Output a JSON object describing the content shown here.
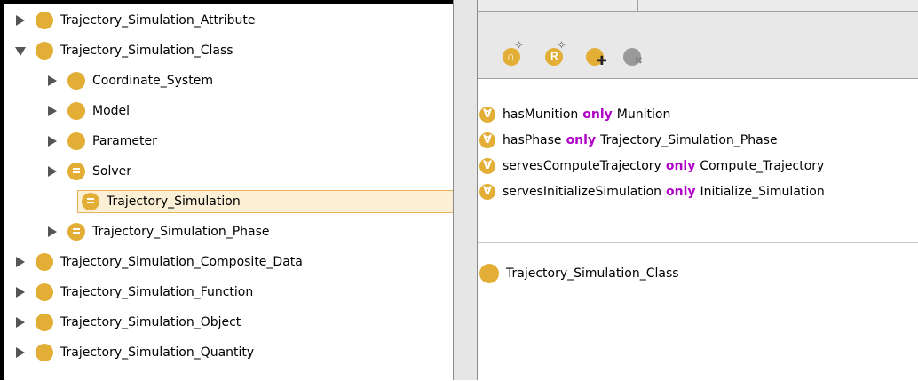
{
  "tree": {
    "items": [
      {
        "label": "Trajectory_Simulation_Attribute",
        "state": "collapsed",
        "equiv": false,
        "indent": 0
      },
      {
        "label": "Trajectory_Simulation_Class",
        "state": "expanded",
        "equiv": false,
        "indent": 0
      },
      {
        "label": "Coordinate_System",
        "state": "collapsed",
        "equiv": false,
        "indent": 1
      },
      {
        "label": "Model",
        "state": "collapsed",
        "equiv": false,
        "indent": 1
      },
      {
        "label": "Parameter",
        "state": "collapsed",
        "equiv": false,
        "indent": 1
      },
      {
        "label": "Solver",
        "state": "collapsed",
        "equiv": true,
        "indent": 1
      },
      {
        "label": "Trajectory_Simulation",
        "state": "none",
        "equiv": true,
        "indent": 1,
        "selected": true
      },
      {
        "label": "Trajectory_Simulation_Phase",
        "state": "collapsed",
        "equiv": true,
        "indent": 1
      },
      {
        "label": "Trajectory_Simulation_Composite_Data",
        "state": "collapsed",
        "equiv": false,
        "indent": 0
      },
      {
        "label": "Trajectory_Simulation_Function",
        "state": "collapsed",
        "equiv": false,
        "indent": 0
      },
      {
        "label": "Trajectory_Simulation_Object",
        "state": "collapsed",
        "equiv": false,
        "indent": 0
      },
      {
        "label": "Trajectory_Simulation_Quantity",
        "state": "collapsed",
        "equiv": false,
        "indent": 0
      }
    ]
  },
  "toolbar": {
    "buttons": [
      {
        "name": "add-intersection-of-button",
        "letter": "∩",
        "icon": "class-intersection-icon"
      },
      {
        "name": "add-restriction-button",
        "letter": "R",
        "icon": "restriction-icon"
      },
      {
        "name": "add-named-class-button",
        "letter": "",
        "icon": "add-class-icon"
      },
      {
        "name": "remove-class-button",
        "letter": "",
        "icon": "remove-class-icon"
      }
    ]
  },
  "restrictions": [
    {
      "property": "hasMunition",
      "keyword": "only",
      "filler": "Munition"
    },
    {
      "property": "hasPhase",
      "keyword": "only",
      "filler": "Trajectory_Simulation_Phase"
    },
    {
      "property": "servesComputeTrajectory",
      "keyword": "only",
      "filler": "Compute_Trajectory"
    },
    {
      "property": "servesInitializeSimulation",
      "keyword": "only",
      "filler": "Initialize_Simulation"
    }
  ],
  "superclass": {
    "label": "Trajectory_Simulation_Class"
  },
  "colors": {
    "class": "#e2ae36",
    "keyword": "#b000c8",
    "selection_bg": "#fbf0d6",
    "selection_border": "#e8b25a"
  }
}
